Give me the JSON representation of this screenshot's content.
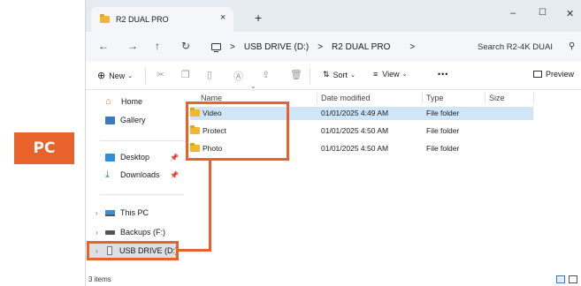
{
  "badge": {
    "label": "PC"
  },
  "window": {
    "tab_title": "R2 DUAL PRO",
    "tab_close": "×",
    "new_tab": "+",
    "minimize": "–",
    "maximize": "☐",
    "close": "✕"
  },
  "nav": {
    "back": "←",
    "forward": "→",
    "up": "↑",
    "refresh": "↻",
    "breadcrumb": [
      "USB DRIVE (D:)",
      "R2 DUAL PRO"
    ],
    "separator": ">",
    "search_placeholder": "Search R2-4K DUAI"
  },
  "toolbar": {
    "new_label": "New",
    "sort_label": "Sort",
    "view_label": "View",
    "more_label": "•••",
    "preview_label": "Preview"
  },
  "sidebar": {
    "items": [
      {
        "label": "Home",
        "icon": "home-icon"
      },
      {
        "label": "Gallery",
        "icon": "gallery-icon"
      },
      {
        "label": "Desktop",
        "icon": "desktop-icon"
      },
      {
        "label": "Downloads",
        "icon": "downloads-icon"
      },
      {
        "label": "This PC",
        "icon": "computer-icon"
      },
      {
        "label": "Backups (F:)",
        "icon": "drive-icon"
      },
      {
        "label": "USB DRIVE (D:)",
        "icon": "usb-drive-icon"
      }
    ]
  },
  "columns": {
    "name": "Name",
    "date": "Date modified",
    "type": "Type",
    "size": "Size"
  },
  "files": [
    {
      "name": "Video",
      "date": "01/01/2025 4:49 AM",
      "type": "File folder"
    },
    {
      "name": "Protect",
      "date": "01/01/2025 4:50 AM",
      "type": "File folder"
    },
    {
      "name": "Photo",
      "date": "01/01/2025 4:50 AM",
      "type": "File folder"
    }
  ],
  "status": {
    "count": "3 items"
  },
  "colors": {
    "accent": "#e8632c",
    "folder": "#f2b731",
    "selection": "#cfe6f8"
  }
}
